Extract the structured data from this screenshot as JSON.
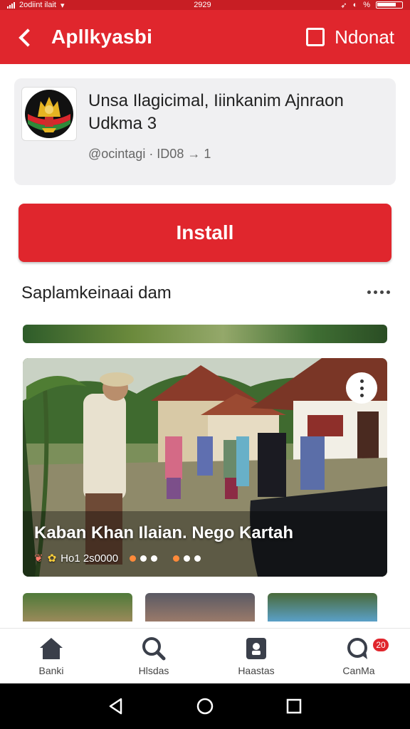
{
  "status_bar": {
    "left_text": "2odiint ilait",
    "time": "2929",
    "right_text": "%"
  },
  "app_bar": {
    "title": "Apllkyasbi",
    "action_label": "Ndonat"
  },
  "app_card": {
    "name": "Unsa Ilagicimal, Iiinkanim Ajnraon Udkma 3",
    "meta": "@ocintagi · ID08 → 1",
    "logo_icon": "ornate-emblem-logo"
  },
  "install_button": {
    "label": "Install"
  },
  "section": {
    "title": "Saplamkeinaai dam"
  },
  "feature": {
    "caption": "Kaban Khan Ilaian. Nego Kartah",
    "stats_label": "Ho1 2s0000",
    "menu_icon": "vertical-dots-icon"
  },
  "bottom_nav": {
    "items": [
      {
        "label": "Banki",
        "icon": "home-icon"
      },
      {
        "label": "Hlsdas",
        "icon": "search-icon"
      },
      {
        "label": "Haastas",
        "icon": "library-icon"
      },
      {
        "label": "CanMa",
        "icon": "chat-icon",
        "badge": "20"
      }
    ]
  },
  "colors": {
    "brand_red": "#e0262d",
    "status_red": "#c81e24",
    "card_bg": "#f0f0f2"
  }
}
